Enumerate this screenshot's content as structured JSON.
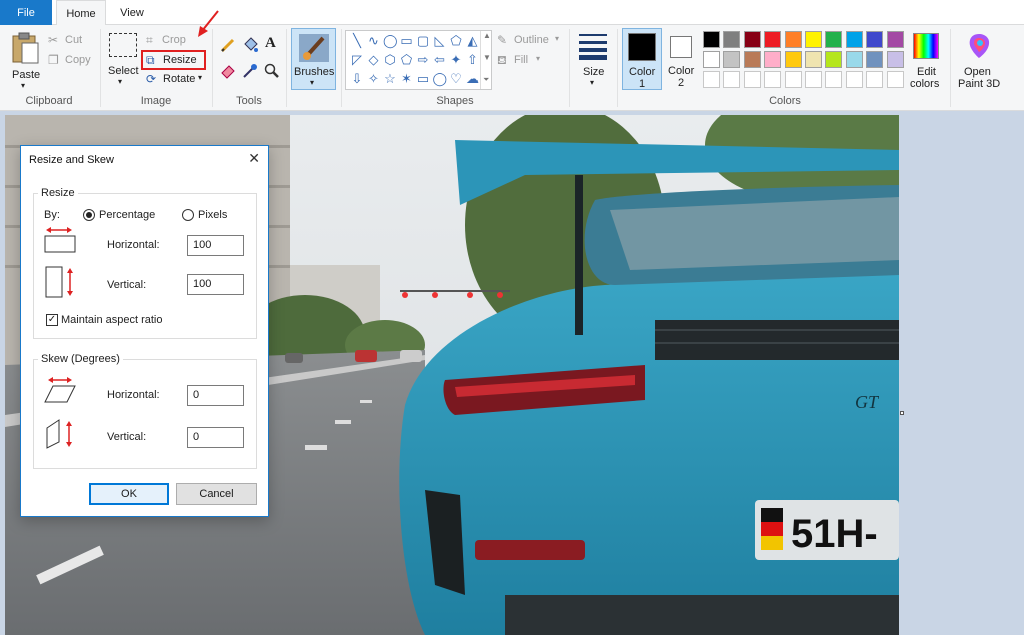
{
  "tabs": {
    "file": "File",
    "home": "Home",
    "view": "View"
  },
  "clipboard": {
    "paste": "Paste",
    "cut": "Cut",
    "copy": "Copy",
    "group": "Clipboard"
  },
  "image": {
    "select": "Select",
    "crop": "Crop",
    "resize": "Resize",
    "rotate": "Rotate",
    "group": "Image"
  },
  "tools": {
    "group": "Tools",
    "text_glyph": "A"
  },
  "brushes": {
    "label": "Brushes"
  },
  "shapes": {
    "outline": "Outline",
    "fill": "Fill",
    "group": "Shapes",
    "glyphs": [
      "╲",
      "∿",
      "◯",
      "▭",
      "▢",
      "◺",
      "⬠",
      "◭",
      "◸",
      "◇",
      "⬡",
      "⬠",
      "⇨",
      "⇦",
      "✦",
      "⇧",
      "⇩",
      "✧",
      "☆",
      "✶",
      "▭",
      "◯",
      "♡",
      "☁"
    ]
  },
  "size": {
    "label": "Size"
  },
  "color1": {
    "line1": "Color",
    "line2": "1"
  },
  "color2": {
    "line1": "Color",
    "line2": "2"
  },
  "colors": {
    "group": "Colors",
    "row1": [
      "#000000",
      "#7f7f7f",
      "#880015",
      "#ed1c24",
      "#ff7f27",
      "#fff200",
      "#22b14c",
      "#00a2e8",
      "#3f48cc",
      "#a349a4"
    ],
    "row2": [
      "#ffffff",
      "#c3c3c3",
      "#b97a57",
      "#ffaec9",
      "#ffc90e",
      "#efe4b0",
      "#b5e61d",
      "#99d9ea",
      "#7092be",
      "#c8bfe7"
    ]
  },
  "edit_colors": {
    "line1": "Edit",
    "line2": "colors"
  },
  "paint3d": {
    "line1": "Open",
    "line2": "Paint 3D"
  },
  "photo": {
    "plate": "51H-",
    "badge": "GT"
  },
  "dialog": {
    "title": "Resize and Skew",
    "close": "✕",
    "resize_legend": "Resize",
    "by": "By:",
    "percentage": "Percentage",
    "pixels": "Pixels",
    "horizontal": "Horizontal:",
    "vertical": "Vertical:",
    "h_value": "100",
    "v_value": "100",
    "maintain": "Maintain aspect ratio",
    "skew_legend": "Skew (Degrees)",
    "skew_h_value": "0",
    "skew_v_value": "0",
    "ok": "OK",
    "cancel": "Cancel"
  }
}
